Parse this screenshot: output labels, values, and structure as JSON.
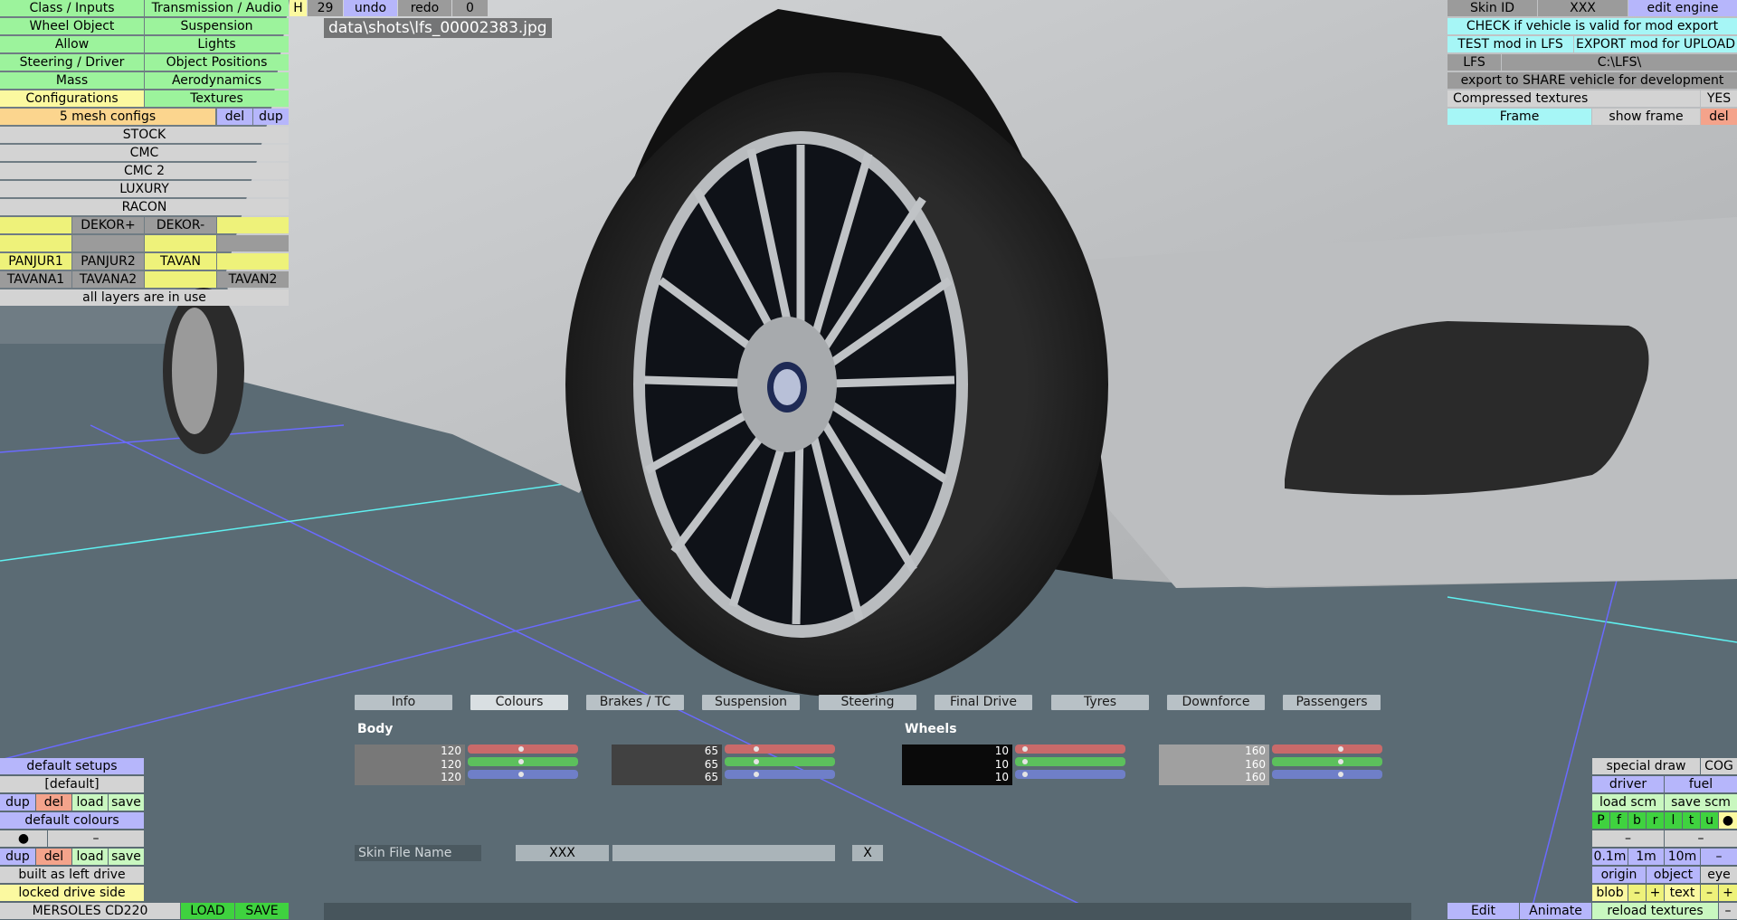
{
  "left_menu": {
    "items": [
      [
        "Class / Inputs",
        "Transmission / Audio"
      ],
      [
        "Wheel Object",
        "Suspension"
      ],
      [
        "Allow",
        "Lights"
      ],
      [
        "Steering / Driver",
        "Object Positions"
      ],
      [
        "Mass",
        "Aerodynamics"
      ],
      [
        "Configurations",
        "Textures"
      ]
    ],
    "mesh_configs": "5 mesh configs",
    "del": "del",
    "dup": "dup",
    "configs": [
      "STOCK",
      "CMC",
      "CMC 2",
      "LUXURY",
      "RACON"
    ],
    "layer_row1": [
      "",
      "DEKOR+",
      "DEKOR-",
      ""
    ],
    "layer_row2": [
      "",
      "",
      "",
      ""
    ],
    "layer_row3": [
      "PANJUR1",
      "PANJUR2",
      "TAVAN",
      ""
    ],
    "layer_row4": [
      "TAVANA1",
      "TAVANA2",
      "",
      "TAVAN2"
    ],
    "layers_status": "all layers are in use"
  },
  "top_bar": {
    "h": "H",
    "count": "29",
    "undo": "undo",
    "redo": "redo",
    "zero": "0",
    "screenshot_path": "data\\shots\\lfs_00002383.jpg"
  },
  "right_panel": {
    "skin_id_label": "Skin ID",
    "skin_id_value": "XXX",
    "edit_engine": "edit engine",
    "check_valid": "CHECK if vehicle is valid for mod export",
    "test_mod": "TEST mod in LFS",
    "export_mod": "EXPORT mod for UPLOAD",
    "lfs_label": "LFS",
    "lfs_path": "C:\\LFS\\",
    "export_share": "export to SHARE vehicle for development",
    "compressed_label": "Compressed textures",
    "compressed_value": "YES",
    "frame": "Frame",
    "show_frame": "show frame",
    "del": "del"
  },
  "tabs": [
    "Info",
    "Colours",
    "Brakes / TC",
    "Suspension",
    "Steering",
    "Final Drive",
    "Tyres",
    "Downforce",
    "Passengers"
  ],
  "active_tab": "Colours",
  "colours": {
    "body_label": "Body",
    "wheels_label": "Wheels",
    "swatches": [
      {
        "values": [
          "120",
          "120",
          "120"
        ],
        "color": "#787878",
        "text": "#ffffff",
        "rgb": [
          120,
          120,
          120
        ]
      },
      {
        "values": [
          "65",
          "65",
          "65"
        ],
        "color": "#414141",
        "text": "#ffffff",
        "rgb": [
          65,
          65,
          65
        ]
      },
      {
        "values": [
          "10",
          "10",
          "10"
        ],
        "color": "#0a0a0a",
        "text": "#ffffff",
        "rgb": [
          10,
          10,
          10
        ]
      },
      {
        "values": [
          "160",
          "160",
          "160"
        ],
        "color": "#a0a0a0",
        "text": "#ffffff",
        "rgb": [
          160,
          160,
          160
        ]
      }
    ],
    "slider_colors": [
      "#c96a6a",
      "#5cc05c",
      "#6f7fc8"
    ]
  },
  "skin_file": {
    "label": "Skin File Name",
    "value": "XXX",
    "clear": "X"
  },
  "bottom_left": {
    "default_setups": "default setups",
    "default_value": "[default]",
    "dup": "dup",
    "del": "del",
    "load": "load",
    "save": "save",
    "default_colours": "default colours",
    "dot": "●",
    "dash": "–",
    "built_as": "built as left drive",
    "locked": "locked drive side",
    "vehicle_name": "MERSOLES CD220",
    "load_btn": "LOAD",
    "save_btn": "SAVE"
  },
  "bottom_right": {
    "special_draw": "special draw",
    "cog": "COG",
    "driver": "driver",
    "fuel": "fuel",
    "load_scm": "load scm",
    "save_scm": "save scm",
    "letters": [
      "P",
      "f",
      "b",
      "r",
      "l",
      "t",
      "u",
      "●"
    ],
    "dash1": "–",
    "dash2": "–",
    "scales": [
      "0.1m",
      "1m",
      "10m",
      "–"
    ],
    "origin": "origin",
    "object": "object",
    "eye": "eye",
    "blob": "blob",
    "minus": "–",
    "plus": "+",
    "text": "text",
    "minus2": "–",
    "plus2": "+",
    "edit": "Edit",
    "animate": "Animate",
    "reload_textures": "reload textures",
    "minus3": "–"
  }
}
